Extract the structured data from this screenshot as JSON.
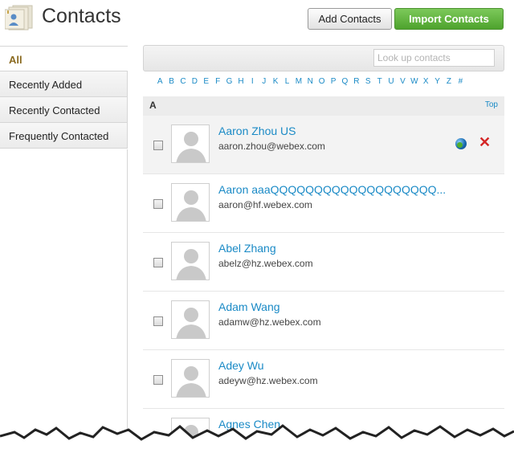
{
  "header": {
    "title": "Contacts",
    "add_label": "Add Contacts",
    "import_label": "Import Contacts"
  },
  "sidebar": {
    "items": [
      {
        "label": "All",
        "active": true
      },
      {
        "label": "Recently Added"
      },
      {
        "label": "Recently Contacted"
      },
      {
        "label": "Frequently Contacted"
      }
    ]
  },
  "search": {
    "placeholder": "Look up contacts"
  },
  "alphabet": [
    "A",
    "B",
    "C",
    "D",
    "E",
    "F",
    "G",
    "H",
    "I",
    "J",
    "K",
    "L",
    "M",
    "N",
    "O",
    "P",
    "Q",
    "R",
    "S",
    "T",
    "U",
    "V",
    "W",
    "X",
    "Y",
    "Z",
    "#"
  ],
  "section": {
    "letter": "A",
    "top_label": "Top"
  },
  "contacts": [
    {
      "name": "Aaron Zhou US",
      "email": "aaron.zhou@webex.com"
    },
    {
      "name": "Aaron aaaQQQQQQQQQQQQQQQQQQQ...",
      "email": "aaron@hf.webex.com"
    },
    {
      "name": "Abel Zhang",
      "email": "abelz@hz.webex.com"
    },
    {
      "name": "Adam Wang",
      "email": "adamw@hz.webex.com"
    },
    {
      "name": "Adey Wu",
      "email": "adeyw@hz.webex.com"
    },
    {
      "name": "Agnes Chen",
      "email": ""
    }
  ],
  "icons": {
    "app": "contacts-book-icon",
    "globe": "globe-icon",
    "delete": "delete-x-icon",
    "avatar": "person-silhouette-icon"
  },
  "colors": {
    "link": "#1a8ac6",
    "import_button": "#5cb238",
    "delete": "#d42525",
    "active_tab_text": "#8a6a20"
  }
}
